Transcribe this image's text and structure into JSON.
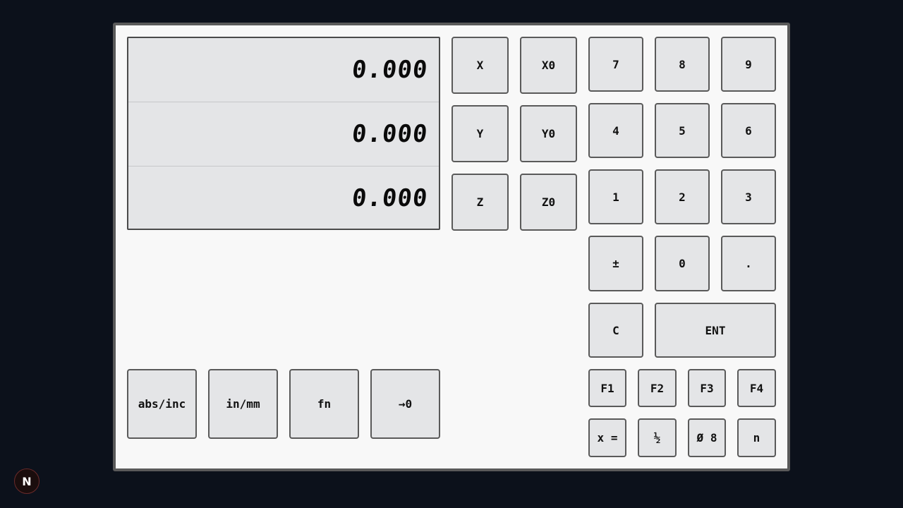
{
  "display": {
    "x_value": "0.000",
    "y_value": "0.000",
    "z_value": "0.000"
  },
  "axis_keys": {
    "x": "X",
    "x_zero": "X0",
    "y": "Y",
    "y_zero": "Y0",
    "z": "Z",
    "z_zero": "Z0"
  },
  "keypad": {
    "k7": "7",
    "k8": "8",
    "k9": "9",
    "k4": "4",
    "k5": "5",
    "k6": "6",
    "k1": "1",
    "k2": "2",
    "k3": "3",
    "plus_minus": "±",
    "k0": "0",
    "dot": ".",
    "clear": "C",
    "enter": "ENT"
  },
  "function_keys": {
    "f1": "F1",
    "f2": "F2",
    "f3": "F3",
    "f4": "F4",
    "x_equals": "x =",
    "half": "½",
    "diameter": "Ø 8",
    "n": "n"
  },
  "mode_keys": {
    "abs_inc": "abs/inc",
    "in_mm": "in/mm",
    "fn": "fn",
    "to_zero": "→0"
  },
  "badge": {
    "label": "N"
  }
}
